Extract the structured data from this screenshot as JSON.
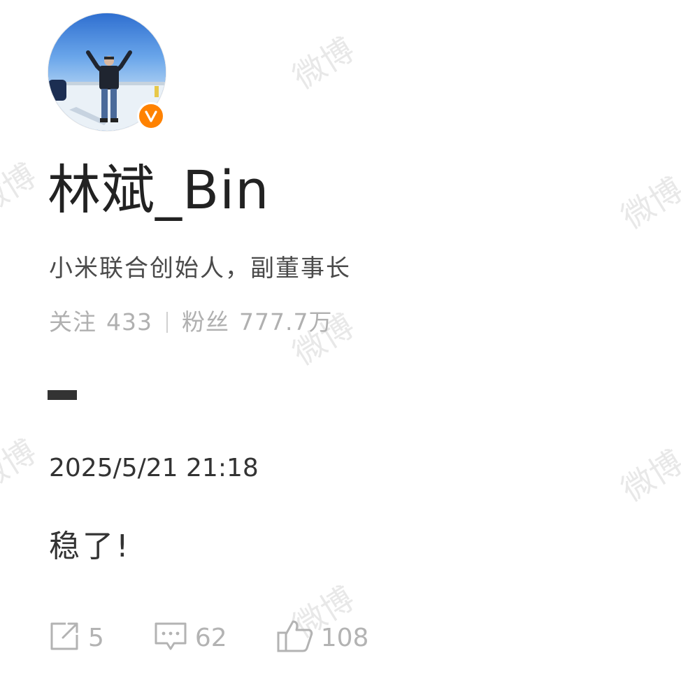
{
  "watermark_text": "微博",
  "profile": {
    "avatar_alt": "profile photo",
    "verified_icon": "verified-badge-icon",
    "username": "林斌_Bin",
    "bio": "小米联合创始人，副董事长",
    "following_label": "关注",
    "following_count": "433",
    "followers_label": "粉丝",
    "followers_count": "777.7万"
  },
  "post": {
    "dash": "—",
    "timestamp": "2025/5/21 21:18",
    "text": "稳了!"
  },
  "actions": {
    "repost_count": "5",
    "comment_count": "62",
    "like_count": "108"
  },
  "colors": {
    "accent": "#ff8200",
    "muted_text": "#b0b0b0",
    "main_text": "#333333"
  }
}
